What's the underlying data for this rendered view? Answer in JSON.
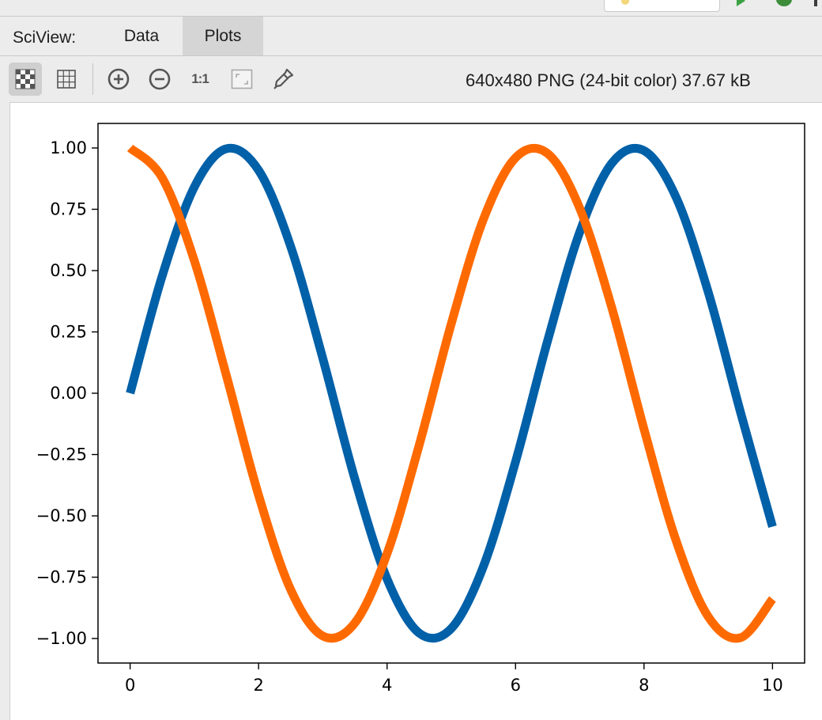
{
  "tabs": {
    "title": "SciView:",
    "items": [
      {
        "label": "Data",
        "active": false
      },
      {
        "label": "Plots",
        "active": true
      }
    ]
  },
  "toolbar": {
    "icons": [
      "chessboard-icon",
      "grid-icon",
      "zoom-in-icon",
      "zoom-out-icon",
      "actual-size-icon",
      "fit-zoom-icon",
      "color-picker-icon"
    ],
    "actual_size_label": "1:1",
    "image_info": "640x480 PNG (24-bit color) 37.67 kB"
  },
  "chart_data": {
    "type": "line",
    "title": "",
    "xlabel": "",
    "ylabel": "",
    "xlim": [
      -0.5,
      10.5
    ],
    "ylim": [
      -1.1,
      1.1
    ],
    "xticks": [
      "0",
      "2",
      "4",
      "6",
      "8",
      "10"
    ],
    "yticks": [
      "1.00",
      "0.75",
      "0.50",
      "0.25",
      "0.00",
      "−0.25",
      "−0.50",
      "−0.75",
      "−1.00"
    ],
    "grid": false,
    "series": [
      {
        "color": "#0060a8",
        "x": [
          0,
          0.5,
          1,
          1.5,
          2,
          2.5,
          3,
          3.5,
          4,
          4.5,
          5,
          5.5,
          6,
          6.5,
          7,
          7.5,
          8,
          8.5,
          9,
          9.5,
          10
        ],
        "y": [
          0.0,
          0.479,
          0.841,
          0.997,
          0.909,
          0.598,
          0.141,
          -0.351,
          -0.757,
          -0.978,
          -0.959,
          -0.706,
          -0.279,
          0.215,
          0.657,
          0.938,
          0.989,
          0.798,
          0.412,
          -0.075,
          -0.544
        ]
      },
      {
        "color": "#ff6a00",
        "x": [
          0,
          0.5,
          1,
          1.5,
          2,
          2.5,
          3,
          3.5,
          4,
          4.5,
          5,
          5.5,
          6,
          6.5,
          7,
          7.5,
          8,
          8.5,
          9,
          9.5,
          10
        ],
        "y": [
          1.0,
          0.878,
          0.54,
          0.071,
          -0.416,
          -0.801,
          -0.99,
          -0.936,
          -0.654,
          -0.211,
          0.284,
          0.709,
          0.96,
          0.977,
          0.754,
          0.347,
          -0.146,
          -0.602,
          -0.911,
          -0.997,
          -0.839
        ]
      }
    ]
  }
}
